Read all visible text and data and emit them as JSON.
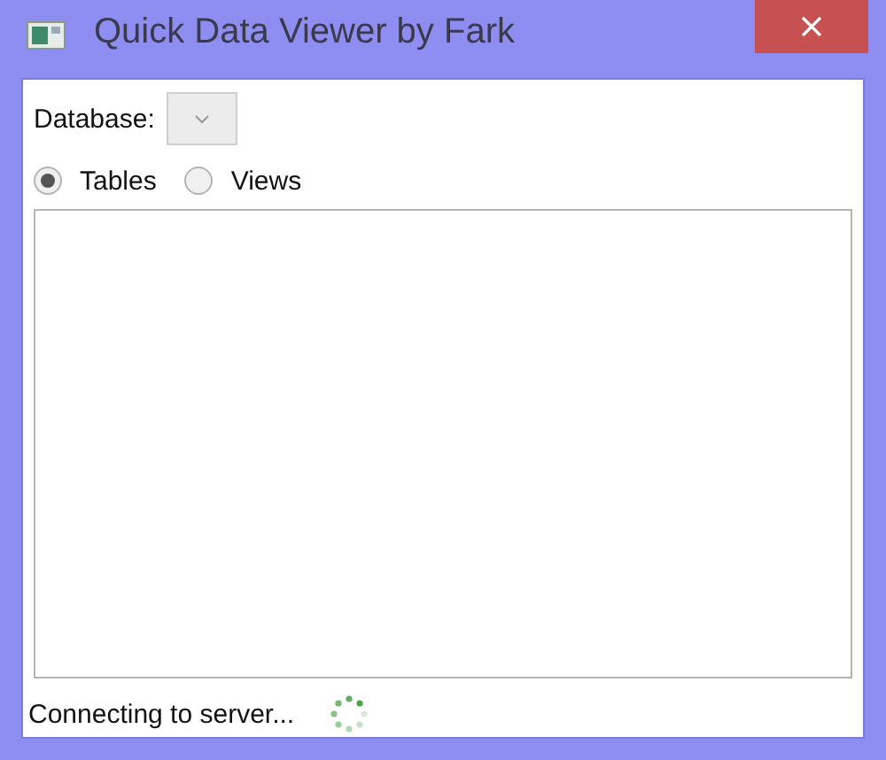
{
  "window": {
    "title": "Quick Data Viewer by Fark"
  },
  "database": {
    "label": "Database:"
  },
  "object_types": [
    {
      "label": "Tables",
      "selected": true
    },
    {
      "label": "Views",
      "selected": false
    }
  ],
  "status_bar": {
    "text": "Connecting to server...",
    "busy": true
  }
}
